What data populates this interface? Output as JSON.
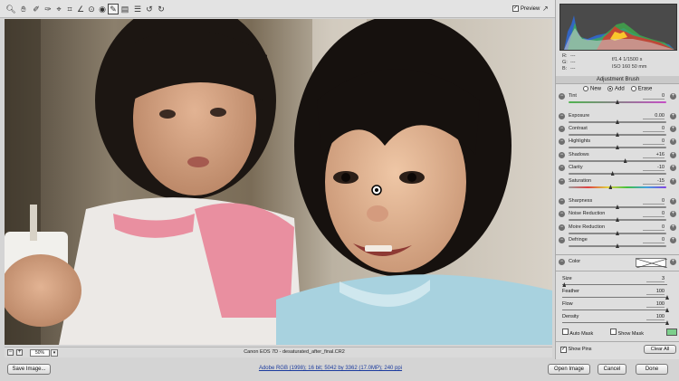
{
  "toolbar": {
    "tools": [
      "zoom-icon",
      "hand-icon",
      "white-balance-icon",
      "color-sampler-icon",
      "target-adjust-icon",
      "crop-icon",
      "straighten-icon",
      "spot-removal-icon",
      "red-eye-icon",
      "adjustment-brush-icon",
      "graduated-filter-icon",
      "preferences-icon",
      "rotate-ccw-icon",
      "rotate-cw-icon"
    ],
    "preview_label": "Preview",
    "preview_checked": true
  },
  "status": {
    "zoom_value": "50%",
    "filename": "Canon EOS 7D  -  desaturated_after_final.CR2"
  },
  "bottom": {
    "save_label": "Save Image...",
    "workflow_link": "Adobe RGB (1998); 16 bit; 5042 by 3362 (17.0MP); 240 ppi",
    "open_label": "Open Image",
    "cancel_label": "Cancel",
    "done_label": "Done"
  },
  "info": {
    "r": "R:",
    "g": "G:",
    "b": "B:",
    "dashes": "---",
    "aperture_shutter": "f/1.4   1/1500 s",
    "iso_lens": "ISO 160    50 mm"
  },
  "panel": {
    "title": "Adjustment Brush",
    "modes": [
      "New",
      "Add",
      "Erase"
    ],
    "selected_mode": "Add",
    "sliders": [
      {
        "label": "Tint",
        "value": "0",
        "pos": 0.5
      },
      {
        "label": "Exposure",
        "value": "0.00",
        "pos": 0.5
      },
      {
        "label": "Contrast",
        "value": "0",
        "pos": 0.5
      },
      {
        "label": "Highlights",
        "value": "0",
        "pos": 0.5
      },
      {
        "label": "Shadows",
        "value": "+16",
        "pos": 0.58
      },
      {
        "label": "Clarity",
        "value": "-10",
        "pos": 0.45
      },
      {
        "label": "Saturation",
        "value": "-15",
        "pos": 0.43
      },
      {
        "label": "Sharpness",
        "value": "0",
        "pos": 0.5
      },
      {
        "label": "Noise Reduction",
        "value": "0",
        "pos": 0.5
      },
      {
        "label": "Moire Reduction",
        "value": "0",
        "pos": 0.5
      },
      {
        "label": "Defringe",
        "value": "0",
        "pos": 0.5
      }
    ],
    "color_label": "Color",
    "brush": [
      {
        "label": "Size",
        "value": "3",
        "pos": 0.02
      },
      {
        "label": "Feather",
        "value": "100",
        "pos": 1.0
      },
      {
        "label": "Flow",
        "value": "100",
        "pos": 1.0
      },
      {
        "label": "Density",
        "value": "100",
        "pos": 1.0
      }
    ],
    "auto_mask_label": "Auto Mask",
    "show_mask_label": "Show Mask",
    "show_pins_label": "Show Pins",
    "clear_all_label": "Clear All",
    "mask_color": "#7ccf8c"
  }
}
